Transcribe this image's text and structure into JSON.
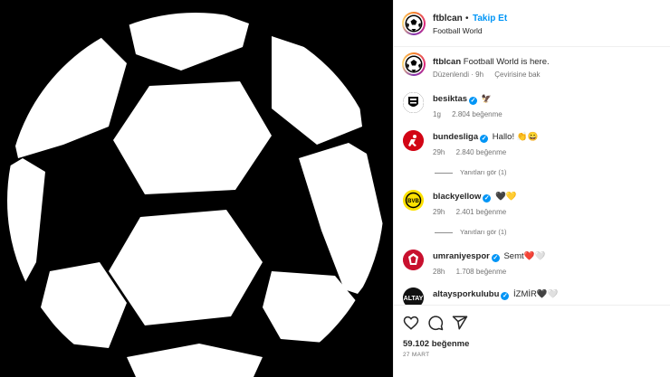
{
  "post": {
    "username": "ftblcan",
    "separator": "•",
    "follow_label": "Takip Et",
    "subtitle": "Football World",
    "caption_username": "ftblcan",
    "caption_text": "Football World is here.",
    "edited_label": "Düzenlendi · 9h",
    "translate_label": "Çevirisine bak"
  },
  "comments": [
    {
      "username": "besiktas",
      "text": "🦅",
      "time": "1g",
      "likes": "2.804 beğenme",
      "replies": "",
      "avatar_color": "#000000"
    },
    {
      "username": "bundesliga",
      "text": "Hallo! 👏😀",
      "time": "29h",
      "likes": "2.840 beğenme",
      "replies": "Yanıtları gör (1)",
      "avatar_color": "#d20515"
    },
    {
      "username": "blackyellow",
      "text": "🖤💛",
      "time": "29h",
      "likes": "2.401 beğenme",
      "replies": "Yanıtları gör (1)",
      "avatar_color": "#fde100"
    },
    {
      "username": "umraniyespor",
      "text": "Semt❤️🤍",
      "time": "28h",
      "likes": "1.708 beğenme",
      "replies": "",
      "avatar_color": "#c8102e"
    },
    {
      "username": "altaysporkulubu",
      "text": "İZMİR🖤🤍",
      "time": "",
      "likes": "",
      "replies": "",
      "avatar_color": "#111111"
    }
  ],
  "footer": {
    "likes_count": "59.102 beğenme",
    "date": "27 MART"
  },
  "icons": {
    "like": "heart-icon",
    "comment": "comment-icon",
    "share": "share-icon",
    "verified": "verified-icon"
  },
  "colors": {
    "follow": "#0095f6",
    "verified": "#0095f6",
    "meta": "#737373"
  }
}
